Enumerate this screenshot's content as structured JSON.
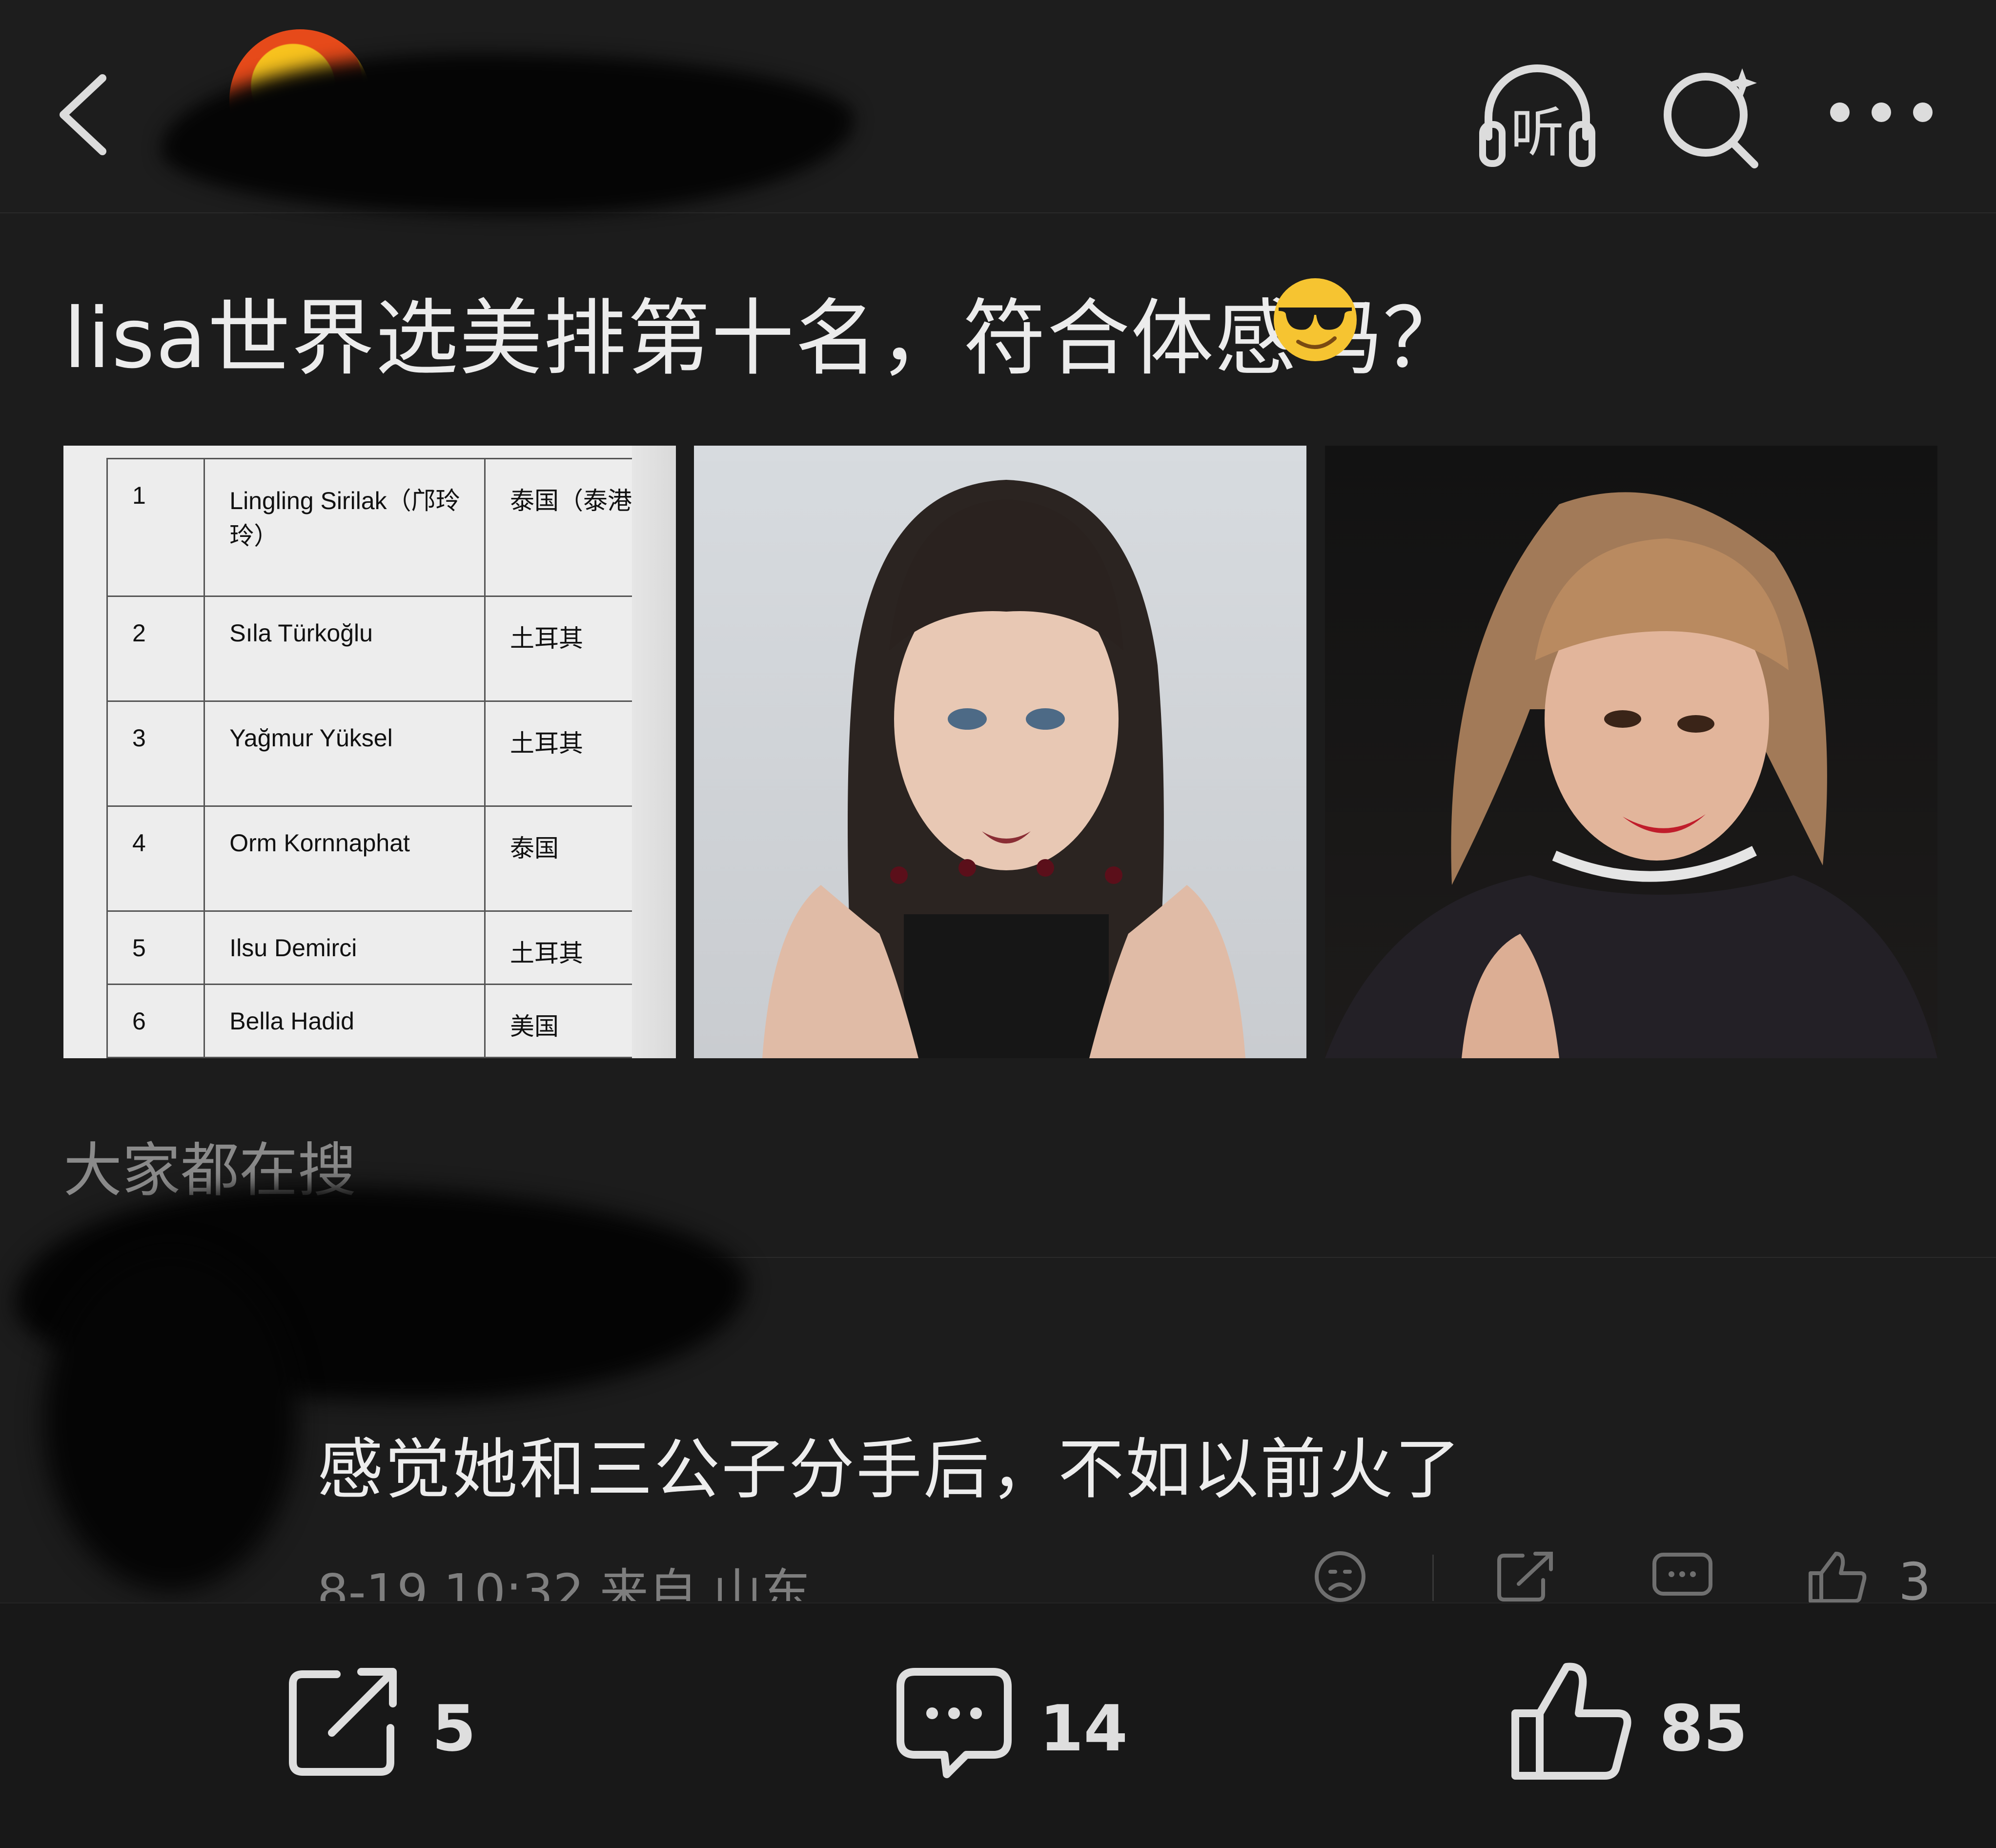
{
  "header": {
    "back_icon": "chevron-left-icon",
    "listen_label": "听",
    "search_icon": "ai-search-icon",
    "more_icon": "more-dots-icon"
  },
  "post": {
    "title": "lisa世界选美排第十名，符合体感吗？",
    "emoji": "sunglasses-emoji",
    "ranking_table": [
      {
        "rank": "1",
        "name": "Lingling Sirilak（邝玲玲）",
        "country": "泰国（泰港"
      },
      {
        "rank": "2",
        "name": "Sıla Türkoğlu",
        "country": "土耳其"
      },
      {
        "rank": "3",
        "name": "Yağmur Yüksel",
        "country": "土耳其"
      },
      {
        "rank": "4",
        "name": "Orm Kornnaphat",
        "country": "泰国"
      },
      {
        "rank": "5",
        "name": "Ilsu Demirci",
        "country": "土耳其"
      },
      {
        "rank": "6",
        "name": "Bella Hadid",
        "country": "美国"
      }
    ]
  },
  "hot_search": {
    "label": "大家都在搜"
  },
  "comment": {
    "text": "感觉她和三公子分手后，不如以前火了",
    "meta": "8-19 10:32  来自 山东",
    "like_count": "3"
  },
  "bottom_bar": {
    "share_count": "5",
    "comment_count": "14",
    "like_count": "85"
  },
  "colors": {
    "background": "#1c1c1c",
    "text": "#e8e8e8",
    "muted": "#8a8a8a"
  }
}
